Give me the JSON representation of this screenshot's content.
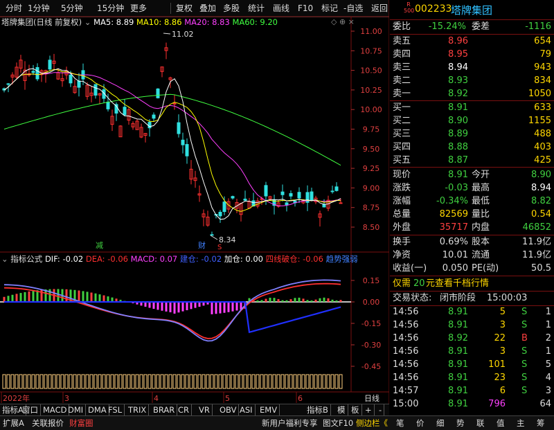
{
  "toolbar": {
    "items": [
      "分时",
      "1分钟",
      "5分钟",
      "15分钟",
      "更多",
      "复权",
      "叠加",
      "多股",
      "统计",
      "画线",
      "F10",
      "标记",
      "-自选",
      "返回"
    ]
  },
  "kline_header": {
    "name": "塔牌集团",
    "mode": "(日线 前复权)",
    "ma5": "MA5: 8.89",
    "ma10": "MA10: 8.86",
    "ma20": "MA20: 8.83",
    "ma60": "MA60: 9.20"
  },
  "macd_header": {
    "name": "指标公式",
    "dif": "DIF: -0.02",
    "dea": "DEA: -0.06",
    "macd": "MACD: 0.07",
    "jc": "建仓: -0.02",
    "add": "加仓: 0.00",
    "red": "四线破仓: -0.06",
    "trend": "趋势强弱"
  },
  "price_axis": [
    "11.00",
    "10.75",
    "10.50",
    "10.25",
    "10.00",
    "9.75",
    "9.50",
    "9.25",
    "9.00",
    "8.75",
    "8.50"
  ],
  "macd_axis": [
    "0.15",
    "0.00",
    "-0.15",
    "-0.30",
    "-0.45"
  ],
  "annotations": {
    "high": "11.02",
    "low": "8.34",
    "mark1": "减",
    "mark2": "财",
    "mark3": "S"
  },
  "date_axis": [
    "2022年",
    "3",
    "4",
    "5",
    "6"
  ],
  "period_label": "日线",
  "indicator_tabs": [
    "指标A",
    "窗口",
    "MACD",
    "DMI",
    "DMA",
    "FSL",
    "TRIX",
    "BRAR",
    "CR",
    "VR",
    "OBV",
    "ASI",
    "EMV"
  ],
  "indicator_right": [
    "指标B",
    "模",
    "板",
    "+",
    "-"
  ],
  "bottom_left": [
    "扩展A",
    "关联报价",
    "财富圈"
  ],
  "bottom_mid": [
    "新用户福利专享",
    "图文F10",
    "侧边栏《"
  ],
  "bottom_right": [
    "笔",
    "价",
    "细",
    "势",
    "联",
    "值",
    "主",
    "筹"
  ],
  "quote": {
    "code": "002233",
    "name": "塔牌集团",
    "r500": "R\n500",
    "weibi_label": "委比",
    "weibi": "-15.24%",
    "weicha_label": "委差",
    "weicha": "-1116",
    "sells": [
      {
        "label": "卖五",
        "price": "8.96",
        "vol": "654",
        "pc": "#ff4040"
      },
      {
        "label": "卖四",
        "price": "8.95",
        "vol": "79",
        "pc": "#ff4040"
      },
      {
        "label": "卖三",
        "price": "8.94",
        "vol": "943",
        "pc": "#ffffff"
      },
      {
        "label": "卖二",
        "price": "8.93",
        "vol": "834",
        "pc": "#40d040"
      },
      {
        "label": "卖一",
        "price": "8.92",
        "vol": "1050",
        "pc": "#40d040"
      }
    ],
    "buys": [
      {
        "label": "买一",
        "price": "8.91",
        "vol": "633",
        "pc": "#40d040"
      },
      {
        "label": "买二",
        "price": "8.90",
        "vol": "1155",
        "pc": "#40d040"
      },
      {
        "label": "买三",
        "price": "8.89",
        "vol": "488",
        "pc": "#40d040"
      },
      {
        "label": "买四",
        "price": "8.88",
        "vol": "403",
        "pc": "#40d040"
      },
      {
        "label": "买五",
        "price": "8.87",
        "vol": "425",
        "pc": "#40d040"
      }
    ],
    "stats": [
      {
        "l1": "现价",
        "v1": "8.91",
        "c1": "#40d040",
        "l2": "今开",
        "v2": "8.90",
        "c2": "#40d040"
      },
      {
        "l1": "涨跌",
        "v1": "-0.03",
        "c1": "#40d040",
        "l2": "最高",
        "v2": "8.94",
        "c2": "#ffffff"
      },
      {
        "l1": "涨幅",
        "v1": "-0.34%",
        "c1": "#40d040",
        "l2": "最低",
        "v2": "8.82",
        "c2": "#40d040"
      },
      {
        "l1": "总量",
        "v1": "82569",
        "c1": "#ffd700",
        "l2": "量比",
        "v2": "0.54",
        "c2": "#ffd700"
      },
      {
        "l1": "外盘",
        "v1": "35717",
        "c1": "#ff4040",
        "l2": "内盘",
        "v2": "46852",
        "c2": "#40d040"
      }
    ],
    "stats2": [
      {
        "l1": "换手",
        "v1": "0.69%",
        "l2": "股本",
        "v2": "11.9亿"
      },
      {
        "l1": "净资",
        "v1": "10.01",
        "l2": "流通",
        "v2": "11.9亿"
      },
      {
        "l1": "收益(一)",
        "v1": "0.050",
        "l2": "PE(动)",
        "v2": "50.5"
      }
    ],
    "promo_a": "仅需",
    "promo_num": "20",
    "promo_b": "元查看千档行情",
    "status_label": "交易状态:",
    "status_value": "闭市阶段",
    "status_time": "15:00:03",
    "ticks": [
      {
        "t": "14:56",
        "p": "8.91",
        "v": "5",
        "f": "S",
        "n": "1",
        "fc": "#40d040"
      },
      {
        "t": "14:56",
        "p": "8.91",
        "v": "3",
        "f": "S",
        "n": "1",
        "fc": "#40d040"
      },
      {
        "t": "14:56",
        "p": "8.92",
        "v": "22",
        "f": "B",
        "n": "2",
        "fc": "#ff4040"
      },
      {
        "t": "14:56",
        "p": "8.91",
        "v": "3",
        "f": "S",
        "n": "1",
        "fc": "#40d040"
      },
      {
        "t": "14:56",
        "p": "8.91",
        "v": "101",
        "f": "S",
        "n": "5",
        "fc": "#40d040"
      },
      {
        "t": "14:56",
        "p": "8.91",
        "v": "23",
        "f": "S",
        "n": "4",
        "fc": "#40d040"
      },
      {
        "t": "14:57",
        "p": "8.91",
        "v": "6",
        "f": "S",
        "n": "3",
        "fc": "#40d040"
      },
      {
        "t": "15:00",
        "p": "8.91",
        "v": "796",
        "f": "",
        "n": "64",
        "fc": "#40d040"
      }
    ]
  },
  "colors": {
    "up": "#ff3030",
    "down": "#30e0e0",
    "ma5": "#ffffff",
    "ma10": "#ffff00",
    "ma20": "#ff40ff",
    "ma60": "#40ff40"
  }
}
